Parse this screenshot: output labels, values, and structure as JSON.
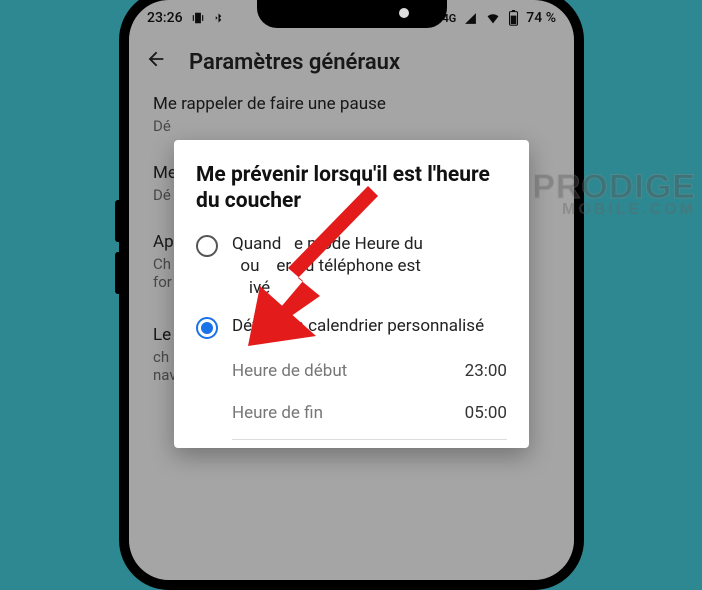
{
  "statusbar": {
    "time": "23:26",
    "battery": "74 %",
    "network_type": "4G"
  },
  "header": {
    "title": "Paramètres généraux"
  },
  "bg": {
    "item1_title": "Me rappeler de faire une pause",
    "item1_sub": "Dé",
    "item2_title": "Me",
    "item2_sub": "Dé",
    "item3_title": "Ap",
    "item3_sub_l1": "Ch",
    "item3_sub_l2": "for",
    "item4_title": "Le",
    "item4_sub_l1": "ch",
    "item4_sub_l2": "nav"
  },
  "dialog": {
    "title": "Me prévenir lorsqu'il est l'heure du coucher",
    "opt1": "Quand le mode Heure du coucher du téléphone est activé",
    "opt1_line1": "Quand   e mode Heure du",
    "opt1_line2": "  ou    er du téléphone est",
    "opt1_line3": "    ivé",
    "opt2": "Définir un calendrier personnalisé",
    "start_label": "Heure de début",
    "start_value": "23:00",
    "end_label": "Heure de fin",
    "end_value": "05:00"
  },
  "watermark": {
    "top": "PRODIGE",
    "bot": "MOBILE.COM"
  }
}
